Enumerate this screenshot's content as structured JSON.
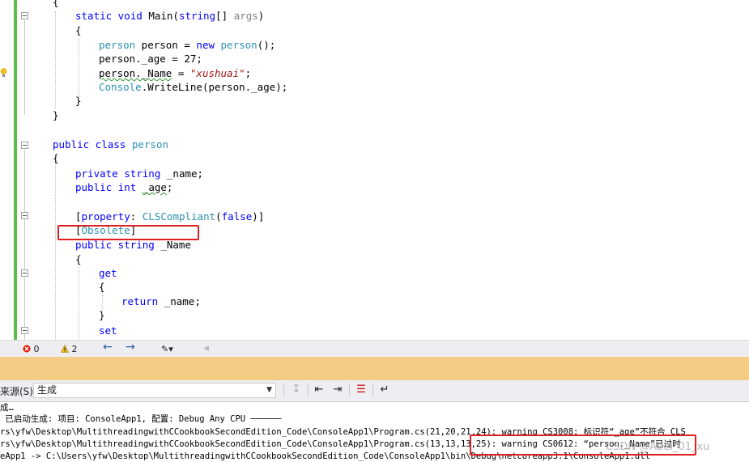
{
  "editor": {
    "lines": [
      {
        "id": "l0",
        "text": "{"
      },
      {
        "id": "l1",
        "parts": [
          {
            "c": "kw",
            "t": "static void "
          },
          {
            "c": "",
            "t": "Main("
          },
          {
            "c": "kw",
            "t": "string"
          },
          {
            "c": "",
            "t": "[] "
          },
          {
            "c": "gray",
            "t": "args"
          },
          {
            "c": "",
            "t": ")"
          }
        ]
      },
      {
        "id": "l2",
        "text": "{"
      },
      {
        "id": "l3",
        "parts": [
          {
            "c": "ty",
            "t": "person"
          },
          {
            "c": "",
            "t": " person = "
          },
          {
            "c": "kw",
            "t": "new"
          },
          {
            "c": "",
            "t": " "
          },
          {
            "c": "ty",
            "t": "person"
          },
          {
            "c": "",
            "t": "();"
          }
        ]
      },
      {
        "id": "l4",
        "text": "person._age = 27;"
      },
      {
        "id": "l5",
        "parts": [
          {
            "c": "sq",
            "t": "person._Name"
          },
          {
            "c": "",
            "t": " = "
          },
          {
            "c": "str",
            "t": "\"xushuai\""
          },
          {
            "c": "",
            "t": ";"
          }
        ]
      },
      {
        "id": "l6",
        "parts": [
          {
            "c": "ty",
            "t": "Console"
          },
          {
            "c": "",
            "t": ".WriteLine(person._age);"
          }
        ]
      },
      {
        "id": "l7",
        "text": "}"
      },
      {
        "id": "l8",
        "text": "}"
      },
      {
        "id": "l9",
        "parts": [
          {
            "c": "kw",
            "t": "public class "
          },
          {
            "c": "ty",
            "t": "person"
          }
        ]
      },
      {
        "id": "l10",
        "text": "{"
      },
      {
        "id": "l11",
        "parts": [
          {
            "c": "kw",
            "t": "private string "
          },
          {
            "c": "",
            "t": "_name;"
          }
        ]
      },
      {
        "id": "l12",
        "parts": [
          {
            "c": "kw",
            "t": "public int "
          },
          {
            "c": "sq",
            "t": "_age"
          },
          {
            "c": "",
            "t": ";"
          }
        ]
      },
      {
        "id": "l13",
        "parts": [
          {
            "c": "",
            "t": "["
          },
          {
            "c": "kw",
            "t": "property"
          },
          {
            "c": "",
            "t": ": "
          },
          {
            "c": "ty",
            "t": "CLSCompliant"
          },
          {
            "c": "",
            "t": "("
          },
          {
            "c": "kw",
            "t": "false"
          },
          {
            "c": "",
            "t": ")]"
          }
        ]
      },
      {
        "id": "l14",
        "parts": [
          {
            "c": "",
            "t": "["
          },
          {
            "c": "ty",
            "t": "Obsolete"
          },
          {
            "c": "",
            "t": "]"
          }
        ]
      },
      {
        "id": "l15",
        "parts": [
          {
            "c": "kw",
            "t": "public string "
          },
          {
            "c": "",
            "t": "_Name"
          }
        ]
      },
      {
        "id": "l16",
        "text": "{"
      },
      {
        "id": "l17",
        "parts": [
          {
            "c": "kw",
            "t": "get"
          }
        ]
      },
      {
        "id": "l18",
        "text": "{"
      },
      {
        "id": "l19",
        "parts": [
          {
            "c": "kw",
            "t": "return "
          },
          {
            "c": "",
            "t": "_name;"
          }
        ]
      },
      {
        "id": "l20",
        "text": "}"
      },
      {
        "id": "l21",
        "parts": [
          {
            "c": "kw",
            "t": "set"
          }
        ]
      }
    ]
  },
  "statusbar": {
    "errors": "0",
    "warnings": "2"
  },
  "output_toolbar": {
    "source_label": "来源(S):",
    "source_value": "生成"
  },
  "output": {
    "lines": [
      "成…",
      " 已启动生成: 项目: ConsoleApp1, 配置: Debug Any CPU ──────",
      "rs\\yfw\\Desktop\\MultithreadingwithCCookbookSecondEdition_Code\\ConsoleApp1\\Program.cs(21,20,21,24): warning CS3008: 标识符“_age”不符合 CLS",
      "rs\\yfw\\Desktop\\MultithreadingwithCCookbookSecondEdition_Code\\ConsoleApp1\\Program.cs(13,13,13,25): warning CS0612: “person._Name”已过时",
      "eApp1 -> C:\\Users\\yfw\\Desktop\\MultithreadingwithCCookbookSecondEdition_Code\\ConsoleApp1\\bin\\Debug\\netcoreapp3.1\\ConsoleApp1.dll"
    ]
  },
  "watermark": "CSDN @Abel_01_xu",
  "colors": {
    "keyword": "#0000ff",
    "type": "#2b91af",
    "string": "#a31515",
    "highlight_box": "#e02020",
    "orange_bar": "#f5cc84"
  }
}
